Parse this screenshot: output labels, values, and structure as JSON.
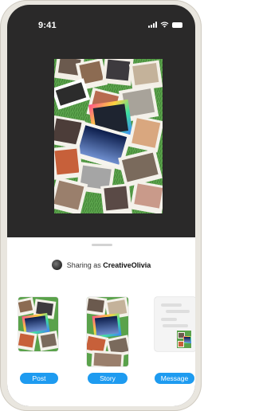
{
  "status_bar": {
    "time": "9:41"
  },
  "share_sheet": {
    "sharing_prefix": "Sharing as",
    "username": "CreativeOlivia"
  },
  "options": {
    "post_label": "Post",
    "story_label": "Story",
    "message_label": "Message"
  },
  "colors": {
    "accent": "#1e9bf0",
    "screen_background": "#2a2929",
    "collage_background": "#5aa24b"
  },
  "icons": [
    "cellular-signal-icon",
    "wifi-icon",
    "battery-icon"
  ]
}
